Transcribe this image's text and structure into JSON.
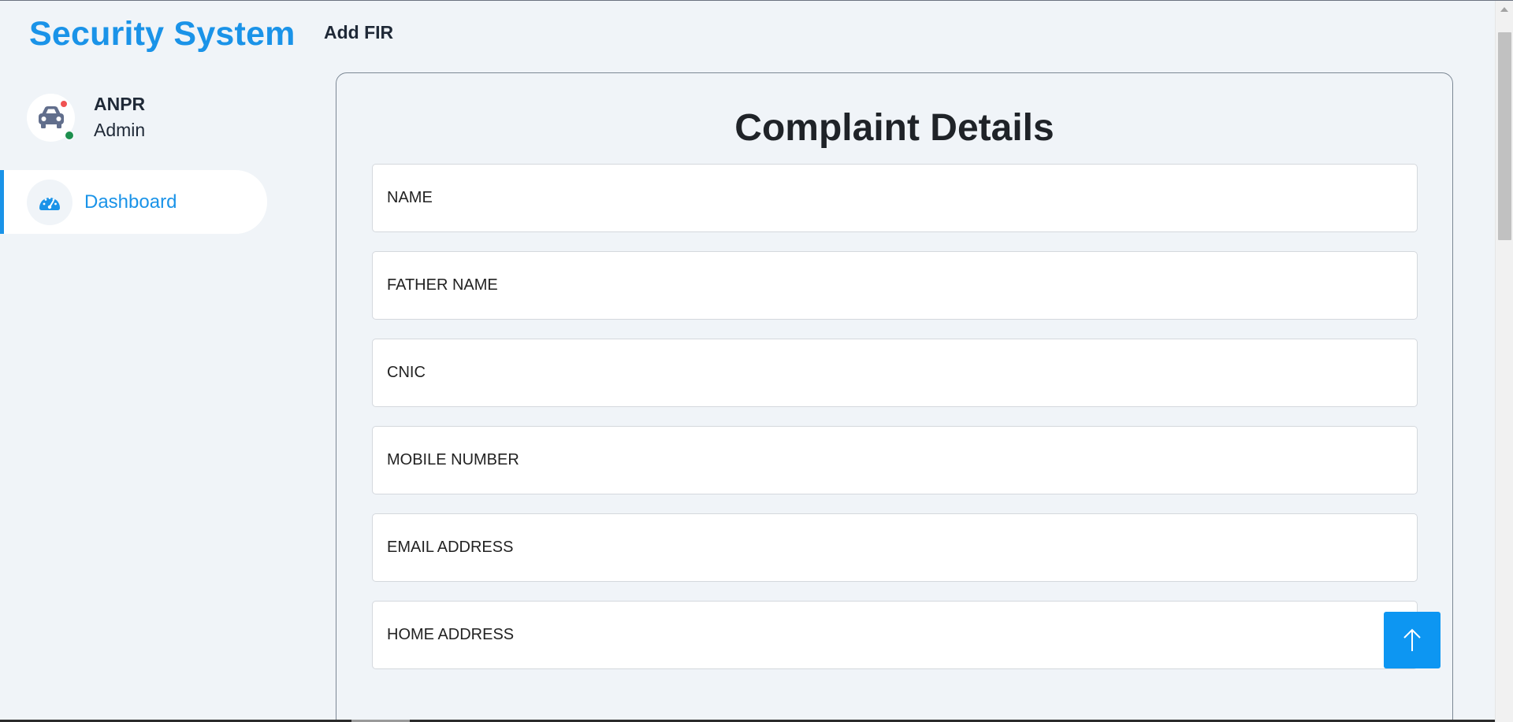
{
  "brand": {
    "title": "Security System"
  },
  "header": {
    "page_title": "Add FIR"
  },
  "profile": {
    "name": "ANPR",
    "role": "Admin",
    "avatar_icon": "car-icon",
    "status_colors": {
      "notification": "#f05252",
      "online": "#1d8f4e"
    }
  },
  "sidebar": {
    "items": [
      {
        "label": "Dashboard",
        "icon": "speedometer-icon",
        "active": true
      }
    ]
  },
  "form": {
    "title": "Complaint Details",
    "fields": [
      {
        "placeholder": "NAME",
        "value": ""
      },
      {
        "placeholder": "FATHER NAME",
        "value": ""
      },
      {
        "placeholder": "CNIC",
        "value": ""
      },
      {
        "placeholder": "MOBILE NUMBER",
        "value": ""
      },
      {
        "placeholder": "EMAIL ADDRESS",
        "value": ""
      },
      {
        "placeholder": "HOME ADDRESS",
        "value": ""
      }
    ]
  },
  "scroll_top_button": {
    "icon": "arrow-up-icon"
  },
  "colors": {
    "accent": "#1a93e8",
    "background": "#f0f4f8",
    "button": "#0d96f2"
  }
}
